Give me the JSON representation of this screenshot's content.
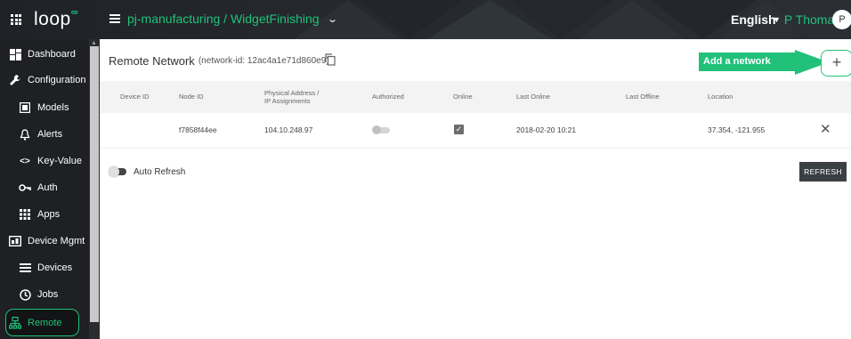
{
  "header": {
    "logo": "loop",
    "logo_mark": "∞",
    "breadcrumb": "pj-manufacturing / WidgetFinishing",
    "language": "English",
    "user_name": "P Thomas",
    "avatar_initial": "P"
  },
  "sidebar": {
    "items": [
      {
        "label": "Dashboard",
        "icon": "dashboard-icon"
      },
      {
        "label": "Configuration",
        "icon": "wrench-icon"
      },
      {
        "label": "Models",
        "icon": "models-icon"
      },
      {
        "label": "Alerts",
        "icon": "bell-icon"
      },
      {
        "label": "Key-Value",
        "icon": "code-brackets-icon"
      },
      {
        "label": "Auth",
        "icon": "key-icon"
      },
      {
        "label": "Apps",
        "icon": "apps-grid-icon"
      },
      {
        "label": "Device Mgmt",
        "icon": "device-mgmt-icon"
      },
      {
        "label": "Devices",
        "icon": "list-icon"
      },
      {
        "label": "Jobs",
        "icon": "clock-icon"
      },
      {
        "label": "Remote",
        "icon": "network-icon"
      }
    ],
    "active": "Remote"
  },
  "main": {
    "title": "Remote Network",
    "network_id": "(network-id: 12ac4a1e71d860e9)",
    "add_callout": "Add a network member",
    "add_symbol": "+",
    "columns": {
      "device_id": "Device ID",
      "node_id": "Node ID",
      "physical_address_1": "Physical Address /",
      "physical_address_2": "IP Assignments",
      "authorized": "Authorized",
      "online": "Online",
      "last_online": "Last Online",
      "last_offline": "Last Offline",
      "location": "Location"
    },
    "rows": [
      {
        "device_id": "",
        "node_id": "f7858f44ee",
        "address": "104.10.248.97",
        "authorized": false,
        "online": true,
        "last_online": "2018-02-20 10:21",
        "last_offline": "",
        "location": "37.354, -121.955"
      }
    ],
    "auto_refresh_label": "Auto Refresh",
    "refresh_label": "REFRESH"
  },
  "colors": {
    "accent": "#21c17a",
    "topbar": "#25292e",
    "sidebar": "#1e2023"
  }
}
